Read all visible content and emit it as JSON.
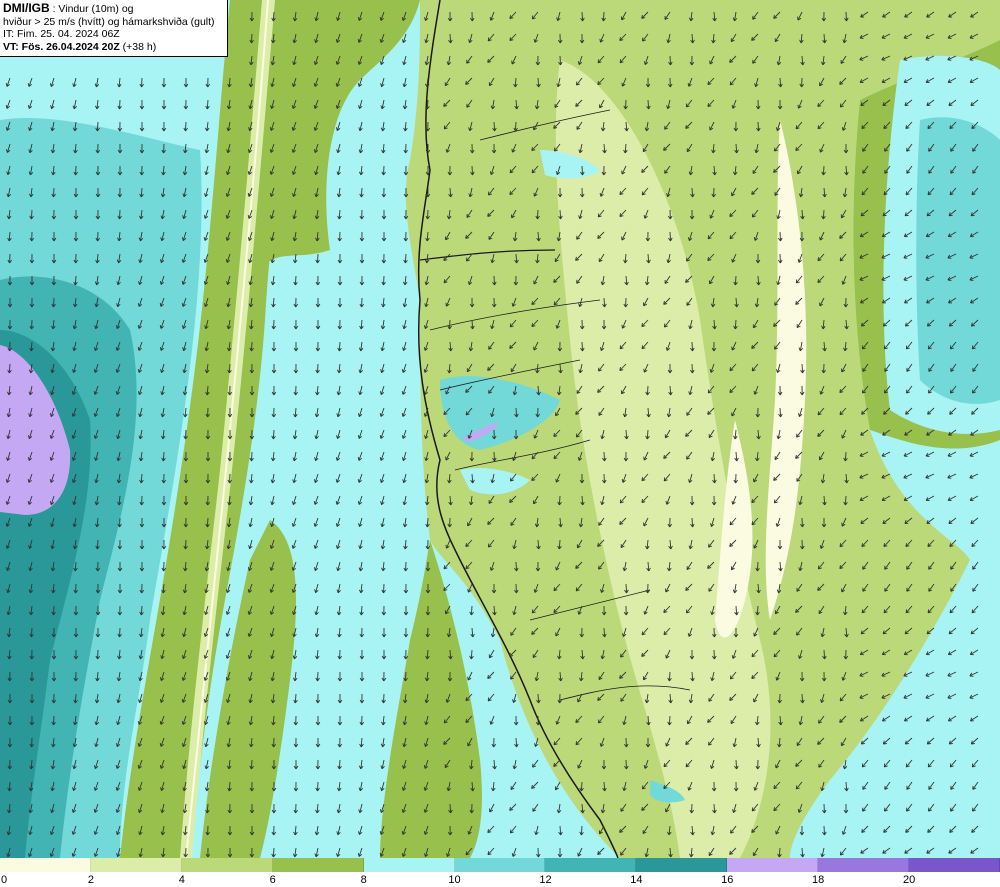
{
  "header": {
    "source": "DMI/IGB",
    "title_suffix": " : Vindur (10m) og",
    "line2": "hviður > 25 m/s (hvítt) og hámarkshviða (gult)",
    "issue_time": "IT: Fim. 25. 04. 2024 06Z",
    "valid_time": "VT: Fös. 26.04.2024 20Z",
    "lead_time": " (+38 h)"
  },
  "legend": {
    "colors": [
      "#fbfbe2",
      "#dcedaa",
      "#bcd97a",
      "#98c04c",
      "#a8f4f4",
      "#72d8d8",
      "#42b4b4",
      "#2a9898",
      "#c4a8f4",
      "#9878de",
      "#7a56cc"
    ],
    "ticks": [
      "0",
      "2",
      "4",
      "6",
      "8",
      "10",
      "12",
      "14",
      "16",
      "18",
      "20"
    ]
  },
  "map": {
    "band_colors": {
      "calm": "#fbfbe2",
      "light": "#dcedaa",
      "moderate": "#bcd97a",
      "fresh": "#98c04c",
      "strong": "#a8f4f4",
      "gale": "#72d8d8",
      "storm": "#42b4b4",
      "severe": "#2a9898",
      "extreme": "#c4a8f4"
    },
    "coast_color": "#1a1a1a",
    "arrow_color": "#333333",
    "wind_direction": "NNW"
  }
}
